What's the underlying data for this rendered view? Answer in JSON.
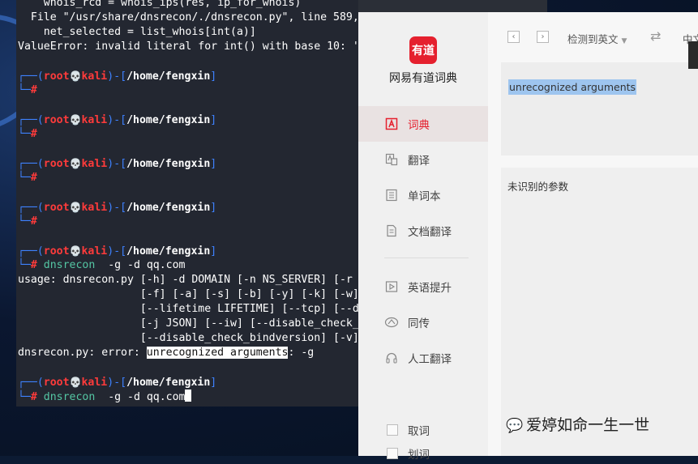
{
  "terminal": {
    "lines": {
      "l1": "    whois_rcd = whois_ips(res, ip_for_whois)",
      "l2": "  File \"/usr/share/dnsrecon/./dnsrecon.py\", line 589,",
      "l3": "    net_selected = list_whois[int(a)]",
      "l4": "ValueError: invalid literal for int() with base 10: '"
    },
    "prompt": {
      "corner_top": "┌──(",
      "user": "root",
      "skull": "💀",
      "host": "kali",
      "mid": ")-[",
      "path": "/home/fengxin",
      "end": "]",
      "corner_bottom": "└─",
      "hash": "#"
    },
    "command": {
      "name": "dnsrecon",
      "args": "  -g -d qq.com"
    },
    "usage": {
      "u1": "usage: dnsrecon.py [-h] -d DOMAIN [-n NS_SERVER] [-r",
      "u2": "                   [-f] [-a] [-s] [-b] [-y] [-k] [-w]",
      "u3": "                   [--lifetime LIFETIME] [--tcp] [--d",
      "u4": "                   [-j JSON] [--iw] [--disable_check_",
      "u5": "                   [--disable_check_bindversion] [-v]"
    },
    "error": {
      "prefix": "dnsrecon.py: error: ",
      "highlight": "unrecognized arguments",
      "suffix": ": -g"
    }
  },
  "youdao": {
    "logo_text": "有道",
    "app_name": "网易有道词典",
    "nav": {
      "dict": "词典",
      "translate": "翻译",
      "wordbook": "单词本",
      "doc_translate": "文档翻译",
      "english_boost": "英语提升",
      "simul": "同传",
      "human_translate": "人工翻译"
    },
    "checks": {
      "word_pick": "取词",
      "word_select": "划词"
    },
    "toolbar": {
      "source_lang": "检测到英文",
      "target_lang": "中文"
    },
    "input_text": "unrecognized arguments",
    "output_text": "未识别的参数",
    "watermark": "爱婷如命一生一世"
  },
  "colors": {
    "terminal_bg": "#232731",
    "prompt_blue": "#3e82ff",
    "prompt_red": "#ff3b3b",
    "command_green": "#54c6a3",
    "youdao_red": "#e5202e",
    "selection_blue": "#9ec5ef"
  }
}
